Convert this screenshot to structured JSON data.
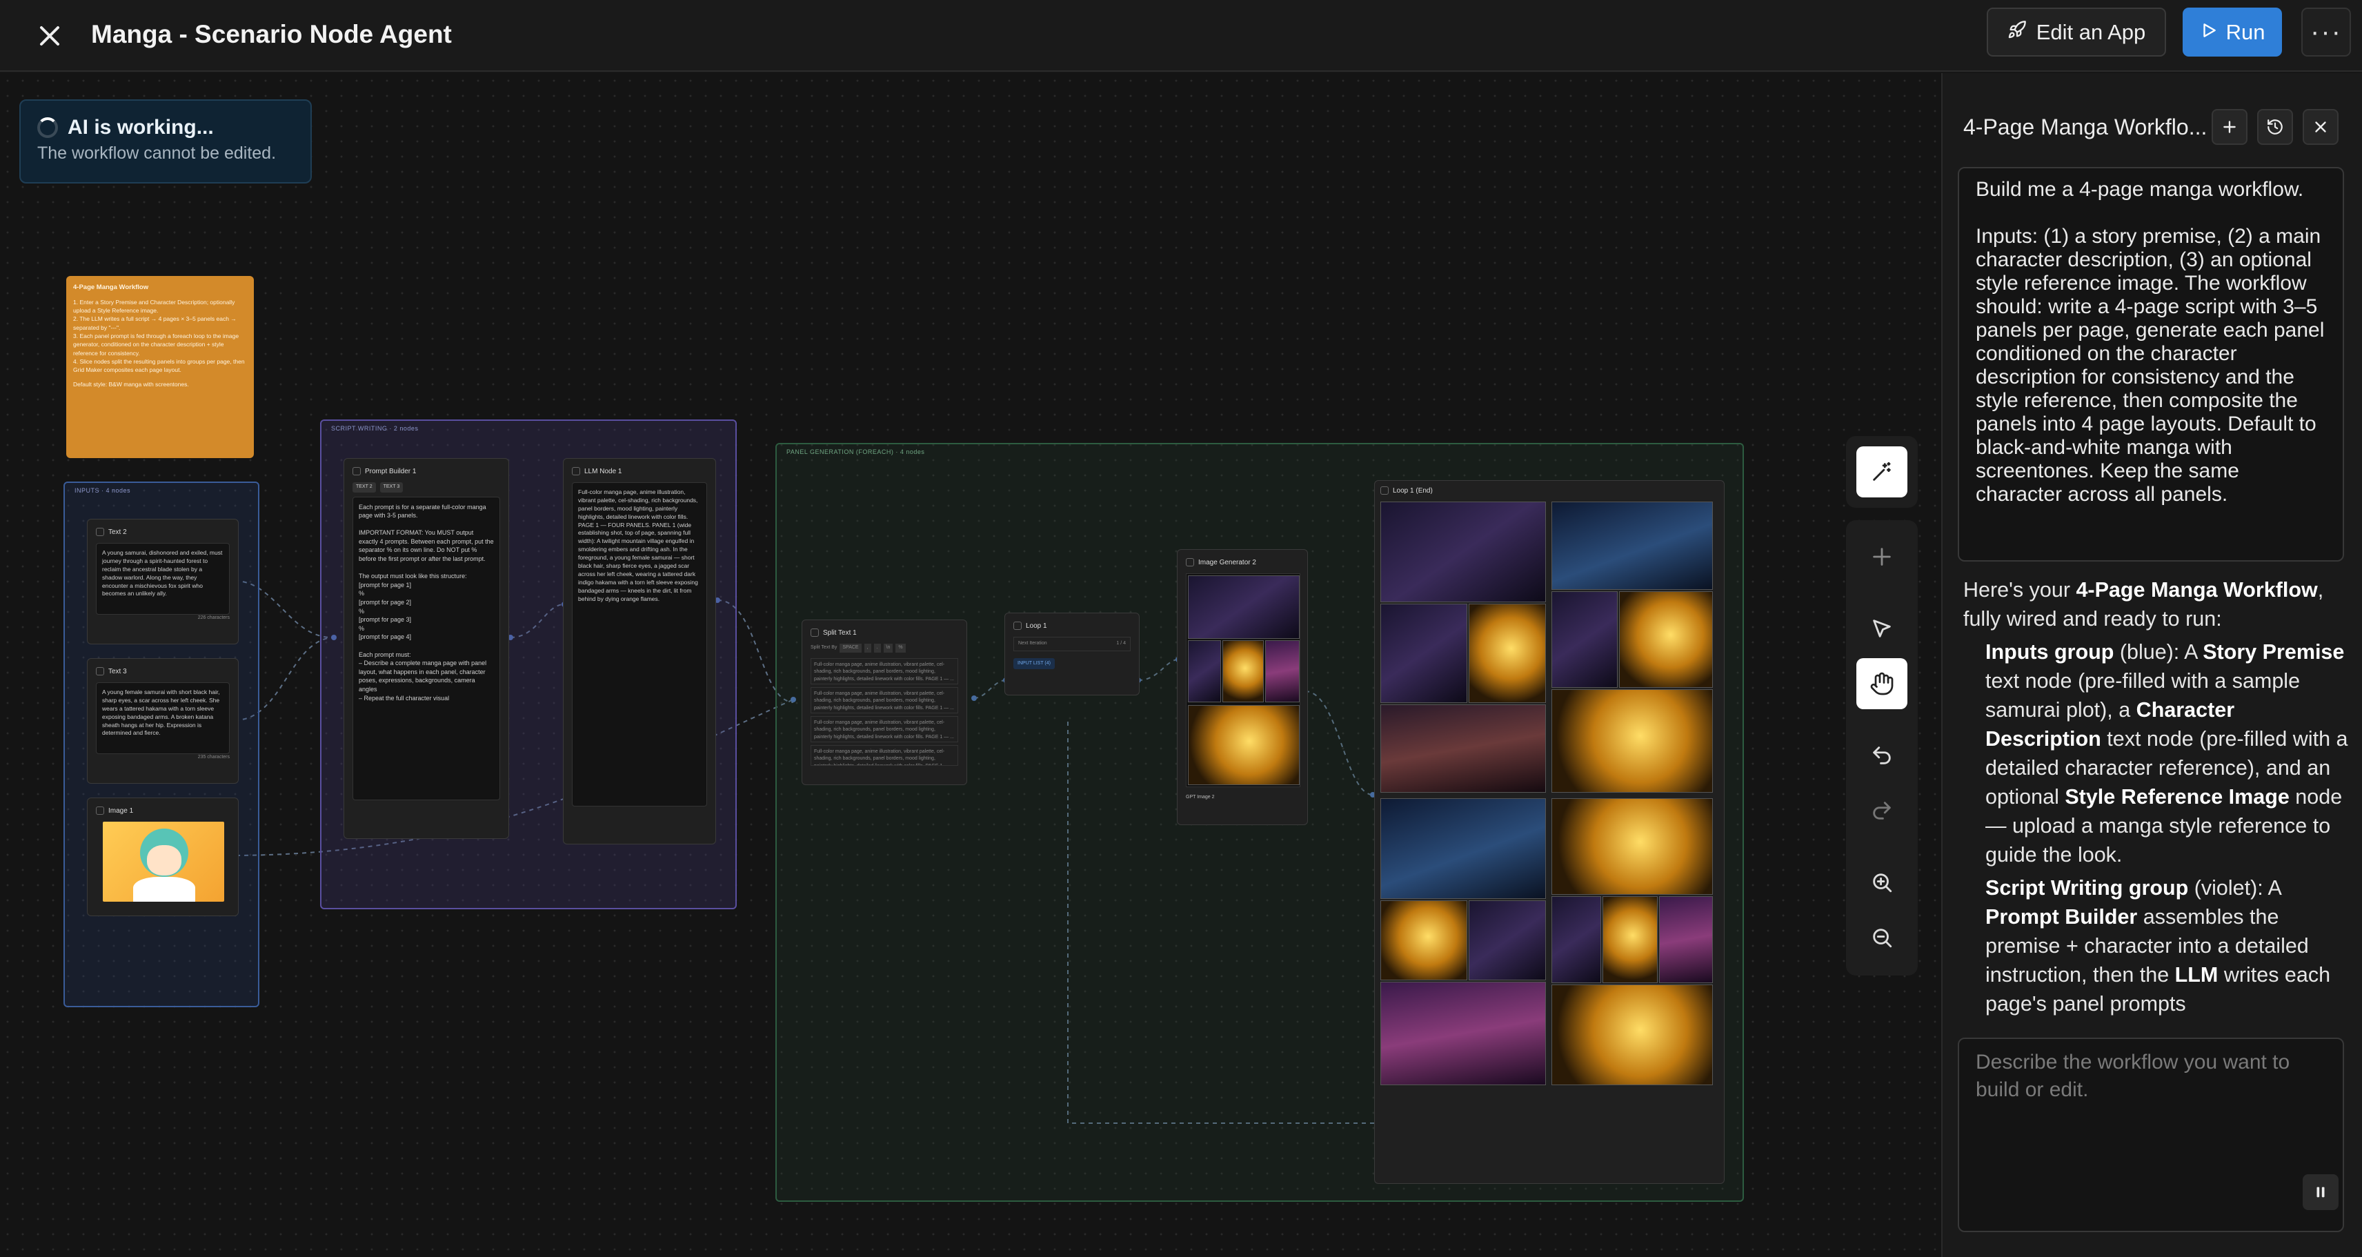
{
  "header": {
    "title": "Manga - Scenario Node Agent",
    "edit_app_label": "Edit an App",
    "run_label": "Run",
    "more_label": "···"
  },
  "status": {
    "title": "AI is working...",
    "subtitle": "The workflow cannot be edited."
  },
  "canvas": {
    "note": {
      "title": "4-Page Manga Workflow",
      "line1": "1. Enter a Story Premise and Character Description; optionally upload a Style Reference image.",
      "line2": "2. The LLM writes a full script → 4 pages × 3–5 panels each → separated by \"---\".",
      "line3": "3. Each panel prompt is fed through a foreach loop to the image generator, conditioned on the character description + style reference for consistency.",
      "line4": "4. Slice nodes split the resulting panels into groups per page, then Grid Maker composites each page layout.",
      "footer": "Default style: B&W manga with screentones."
    },
    "groups": {
      "inputs": "INPUTS · 4 nodes",
      "script": "SCRIPT WRITING · 2 nodes",
      "panel": "PANEL GENERATION (FOREACH) · 4 nodes"
    },
    "nodes": {
      "text2_title": "Text 2",
      "text2_body": "A young samurai, dishonored and exiled, must journey through a spirit-haunted forest to reclaim the ancestral blade stolen by a shadow warlord. Along the way, they encounter a mischievous fox spirit who becomes an unlikely ally.",
      "text2_count": "226 characters",
      "text3_title": "Text 3",
      "text3_body": "A young female samurai with short black hair, sharp eyes, a scar across her left cheek. She wears a tattered hakama with a torn sleeve exposing bandaged arms. A broken katana sheath hangs at her hip. Expression is determined and fierce.",
      "text3_count": "235 characters",
      "image1_title": "Image 1",
      "prompt_builder_title": "Prompt Builder 1",
      "prompt_builder_tags": [
        "TEXT 2",
        "TEXT 3"
      ],
      "prompt_builder_body": "Each prompt is for a separate full-color manga page with 3-5 panels.\n\nIMPORTANT FORMAT: You MUST output exactly 4 prompts. Between each prompt, put the separator % on its own line. Do NOT put % before the first prompt or after the last prompt.\n\nThe output must look like this structure:\n[prompt for page 1]\n%\n[prompt for page 2]\n%\n[prompt for page 3]\n%\n[prompt for page 4]\n\nEach prompt must:\n– Describe a complete manga page with panel layout, what happens in each panel, character poses, expressions, backgrounds, camera angles\n– Repeat the full character visual",
      "llm_title": "LLM Node 1",
      "llm_body": "Full-color manga page, anime illustration, vibrant palette, cel-shading, rich backgrounds, panel borders, mood lighting, painterly highlights, detailed linework with color fills. PAGE 1 — FOUR PANELS. PANEL 1 (wide establishing shot, top of page, spanning full width): A twilight mountain village engulfed in smoldering embers and drifting ash. In the foreground, a young female samurai — short black hair, sharp fierce eyes, a jagged scar across her left cheek, wearing a tattered dark indigo hakama with a torn left sleeve exposing bandaged arms — kneels in the dirt, lit from behind by dying orange flames.",
      "split_title": "Split Text 1",
      "split_by_label": "Split Text By",
      "split_opts": [
        "SPACE",
        ",",
        ".",
        "\\n",
        "%"
      ],
      "split_item": "Full-color manga page, anime illustration, vibrant palette, cel-shading, rich backgrounds, panel borders, mood lighting, painterly highlights, detailed linework with color fills. PAGE 1 — ...",
      "loop_title": "Loop 1",
      "loop_iter_label": "Next Iteration",
      "loop_iter_value": "1 / 4",
      "loop_input_label": "INPUT LIST (4)",
      "image_gen_title": "Image Generator 2",
      "gpt_image_label": "GPT Image 2",
      "loop_end_title": "Loop 1 (End)"
    }
  },
  "toolbar": {
    "magic_icon": "magic-wand-icon",
    "items": [
      "add-icon",
      "pointer-icon",
      "hand-icon",
      "undo-icon",
      "redo-icon",
      "zoom-in-icon",
      "zoom-out-icon"
    ],
    "active": "hand-icon"
  },
  "chat": {
    "title": "4-Page Manga Workflo...",
    "user_message": "Build me a 4-page manga workflow.\n\nInputs: (1) a story premise, (2) a main character description, (3) an optional style reference image. The workflow should: write a 4-page script with 3–5 panels per page, generate each panel conditioned on the character description for consistency and the style reference, then composite the panels into 4 page layouts. Default to black-and-white manga with screentones. Keep the same character across all panels.",
    "reply_intro_pre": "Here's your ",
    "reply_intro_bold": "4-Page Manga Workflow",
    "reply_intro_post": ", fully wired and ready to run:",
    "b1_bold1": "Inputs group",
    "b1_t1": " (blue): A ",
    "b1_bold2": "Story Premise",
    "b1_t2": " text node (pre-filled with a sample samurai plot), a ",
    "b1_bold3": "Character Description",
    "b1_t3": " text node (pre-filled with a detailed character reference), and an optional ",
    "b1_bold4": "Style Reference Image",
    "b1_t4": " node — upload a manga style reference to guide the look.",
    "b2_bold1": "Script Writing group",
    "b2_t1": " (violet): A ",
    "b2_bold2": "Prompt Builder",
    "b2_t2": " assembles the premise + character into a detailed instruction, then the ",
    "b2_bold3": "LLM",
    "b2_t3": " writes each page's panel prompts",
    "composer_placeholder": "Describe the workflow you want to build or edit."
  },
  "colors": {
    "run_button": "#2f7fd8",
    "note": "#d38a2a",
    "inputs_group": "#3a5c99",
    "script_group": "#5a4fa0",
    "panel_group": "#2d5c40"
  }
}
